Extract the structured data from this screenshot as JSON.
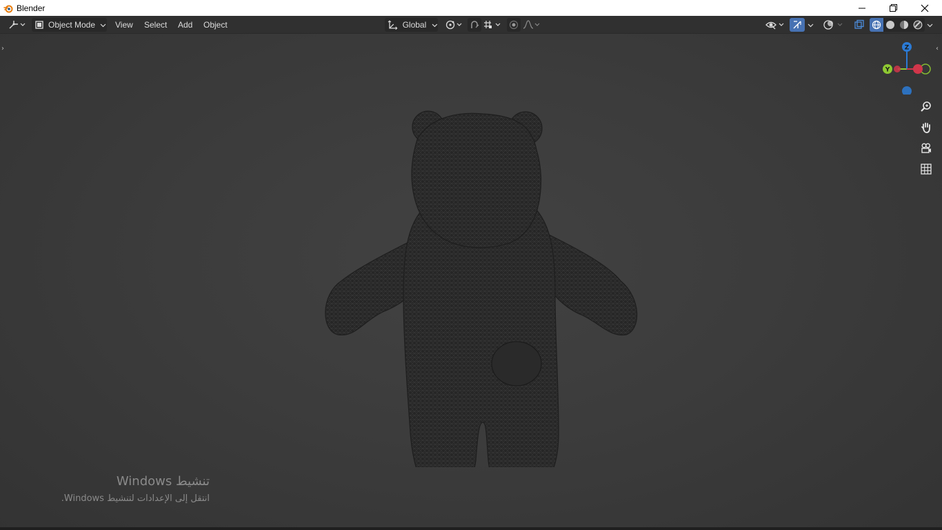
{
  "window": {
    "title": "Blender",
    "controls": {
      "minimize": "minimize-icon",
      "restore": "restore-icon",
      "close": "close-icon"
    }
  },
  "header": {
    "editor_type_icon": "3d-viewport-icon",
    "mode": {
      "label": "Object Mode",
      "icon": "object-mode-icon"
    },
    "menus": [
      "View",
      "Select",
      "Add",
      "Object"
    ],
    "transform_orientation": {
      "label": "Global",
      "icon": "transform-orientation-icon"
    },
    "pivot_icon": "pivot-point-icon",
    "snap_icon": "snap-magnet-icon",
    "snap_target_icon": "snap-target-icon",
    "proportional_icon": "proportional-edit-icon",
    "falloff_icon": "falloff-curve-icon",
    "visibility_icon": "selectability-visibility-icon",
    "gizmo_toggle_icon": "gizmo-toggle-icon",
    "overlay_icon": "overlay-icon",
    "xray_icon": "xray-icon",
    "shading_modes": [
      "wireframe-shading-icon",
      "solid-shading-icon",
      "material-preview-icon",
      "rendered-shading-icon"
    ],
    "active_shading": "wireframe",
    "accent_color": "#4772b3"
  },
  "viewport": {
    "gizmo": {
      "z": "Z",
      "y": "Y",
      "x_color": "#d1364a",
      "y_color": "#8fc932",
      "z_color": "#2b7bd6"
    },
    "nav_buttons": [
      "zoom-icon",
      "pan-hand-icon",
      "camera-view-icon",
      "orthographic-grid-icon"
    ]
  },
  "watermark": {
    "title": "تنشيط Windows",
    "subtitle": "انتقل إلى الإعدادات لتنشيط Windows."
  }
}
